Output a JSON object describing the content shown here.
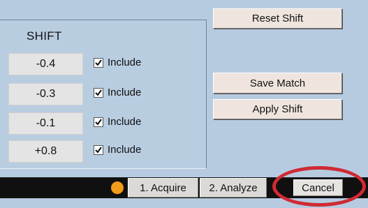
{
  "shift_panel": {
    "header": "SHIFT",
    "rows": [
      {
        "value": "-0.4",
        "include_label": "Include",
        "checked": true
      },
      {
        "value": "-0.3",
        "include_label": "Include",
        "checked": true
      },
      {
        "value": "-0.1",
        "include_label": "Include",
        "checked": true
      },
      {
        "value": "+0.8",
        "include_label": "Include",
        "checked": true
      }
    ]
  },
  "buttons": {
    "reset_shift": "Reset Shift",
    "save_match": "Save Match",
    "apply_shift": "Apply Shift"
  },
  "taskbar": {
    "status_dot_color": "#f29a1a",
    "tabs": [
      {
        "label": "1. Acquire"
      },
      {
        "label": "2. Analyze"
      }
    ],
    "cancel_label": "Cancel"
  },
  "annotation": {
    "highlight_color": "#d02a34"
  }
}
